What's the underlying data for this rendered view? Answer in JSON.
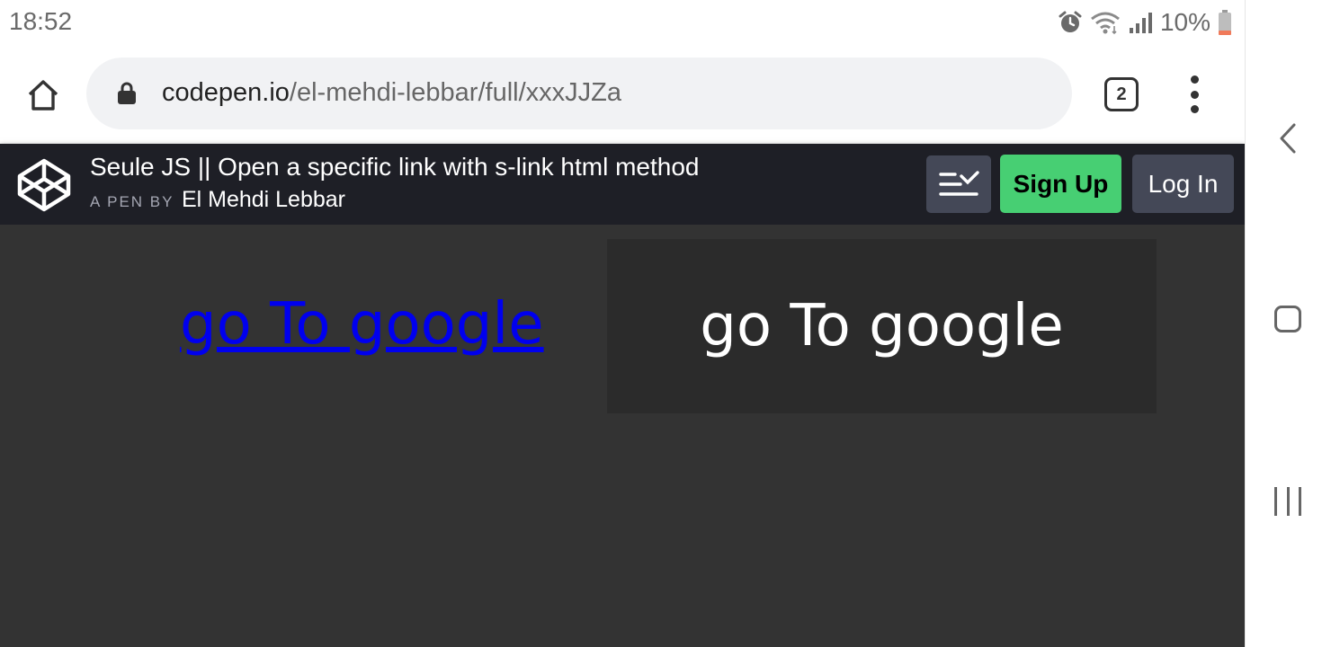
{
  "status_bar": {
    "time": "18:52",
    "battery": "10%",
    "icons": [
      "alarm-icon",
      "wifi-icon",
      "signal-icon",
      "battery-icon"
    ]
  },
  "browser": {
    "url_host": "codepen.io",
    "url_path": "/el-mehdi-lebbar/full/xxxJJZa",
    "tab_count": "2",
    "icons": [
      "home-icon",
      "lock-icon",
      "more-vert-icon"
    ]
  },
  "codepen": {
    "pen_title": "Seule JS || Open a specific link with s-link html method",
    "by_label": "A PEN BY",
    "author": "El Mehdi Lebbar",
    "signup_label": "Sign Up",
    "login_label": "Log In",
    "colors": {
      "header_bg": "#1e1f26",
      "signup_bg": "#47cf73",
      "button_bg": "#444857"
    }
  },
  "result": {
    "link_text": "go To google",
    "box_text": "go To google",
    "colors": {
      "page_bg": "#333333",
      "box_bg": "#2b2b2b",
      "link": "#0000ee"
    }
  },
  "nav_bar": {
    "icons": [
      "back-icon",
      "home-square-icon",
      "recents-icon"
    ]
  }
}
